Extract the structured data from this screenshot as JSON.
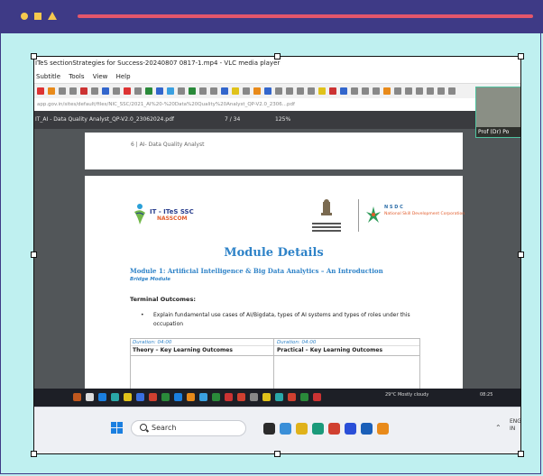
{
  "window_title": "ITeS sectionStrategies for Success-20240807 0817-1.mp4 - VLC media player",
  "menu": [
    "Subtitle",
    "Tools",
    "View",
    "Help"
  ],
  "address_url": "app.gov.in/sites/default/files/NIC_SSC/2021_AI%20-%20Data%20Quality%20Analyst_QP-V2.0_2306...pdf",
  "pdf_toolbar": {
    "filename": "IT_AI - Data Quality Analyst_QP-V2.0_23062024.pdf",
    "page": "7 / 34",
    "zoom": "125%"
  },
  "page_header": "6 | AI- Data Quality Analyst",
  "logo_ites_line1": "IT - ITeS SSC",
  "logo_ites_line2": "NASSCOM",
  "nsdc_line1": "N S D C",
  "nsdc_line2": "National Skill Development Corporation",
  "module_title": "Module Details",
  "module_subtitle": "Module 1: Artificial Intelligence & Big Data Analytics – An Introduction",
  "bridge_module": "Bridge Module",
  "terminal_outcomes": "Terminal Outcomes:",
  "outcome_bullet": "Explain fundamental use cases of AI/Bigdata, types of AI systems and types of roles under this occupation",
  "table": {
    "left_duration": "Duration: 04:00",
    "left_heading": "Theory – Key Learning Outcomes",
    "right_duration": "Duration: 04:00",
    "right_heading": "Practical – Key Learning Outcomes"
  },
  "taskbar_right": {
    "weather": "29°C Mostly cloudy",
    "time": "08:25"
  },
  "windows_search": "Search",
  "lang": [
    "ENG",
    "IN"
  ],
  "camera_label": "Prof (Dr) Po",
  "colors": {
    "frame": "#3e3a86",
    "background": "#bff0f0",
    "accent": "#e4566b",
    "shapes": "#f6c94e"
  },
  "decoration_icons": [
    "circle-icon",
    "square-icon",
    "triangle-icon"
  ]
}
